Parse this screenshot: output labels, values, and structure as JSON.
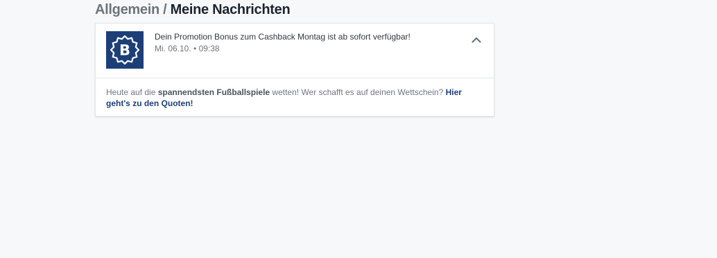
{
  "breadcrumb": {
    "parent": "Allgemein",
    "separator": " / ",
    "current": "Meine Nachrichten"
  },
  "message": {
    "logo_icon": "bonus-b-badge-icon",
    "title": "Dein Promotion Bonus zum Cashback Montag ist ab sofort verfügbar!",
    "meta": "Mi. 06.10. • 09:38",
    "toggle_icon": "chevron-up-icon",
    "body": {
      "text_before": "Heute auf die ",
      "highlight": "spannendsten Fußballspiele",
      "text_middle": " wetten! Wer schafft es auf deinen Wettschein? ",
      "link": "Hier geht's zu den Quoten!"
    }
  },
  "colors": {
    "background": "#f7f8fa",
    "brand": "#1d3f78",
    "card": "#ffffff"
  }
}
